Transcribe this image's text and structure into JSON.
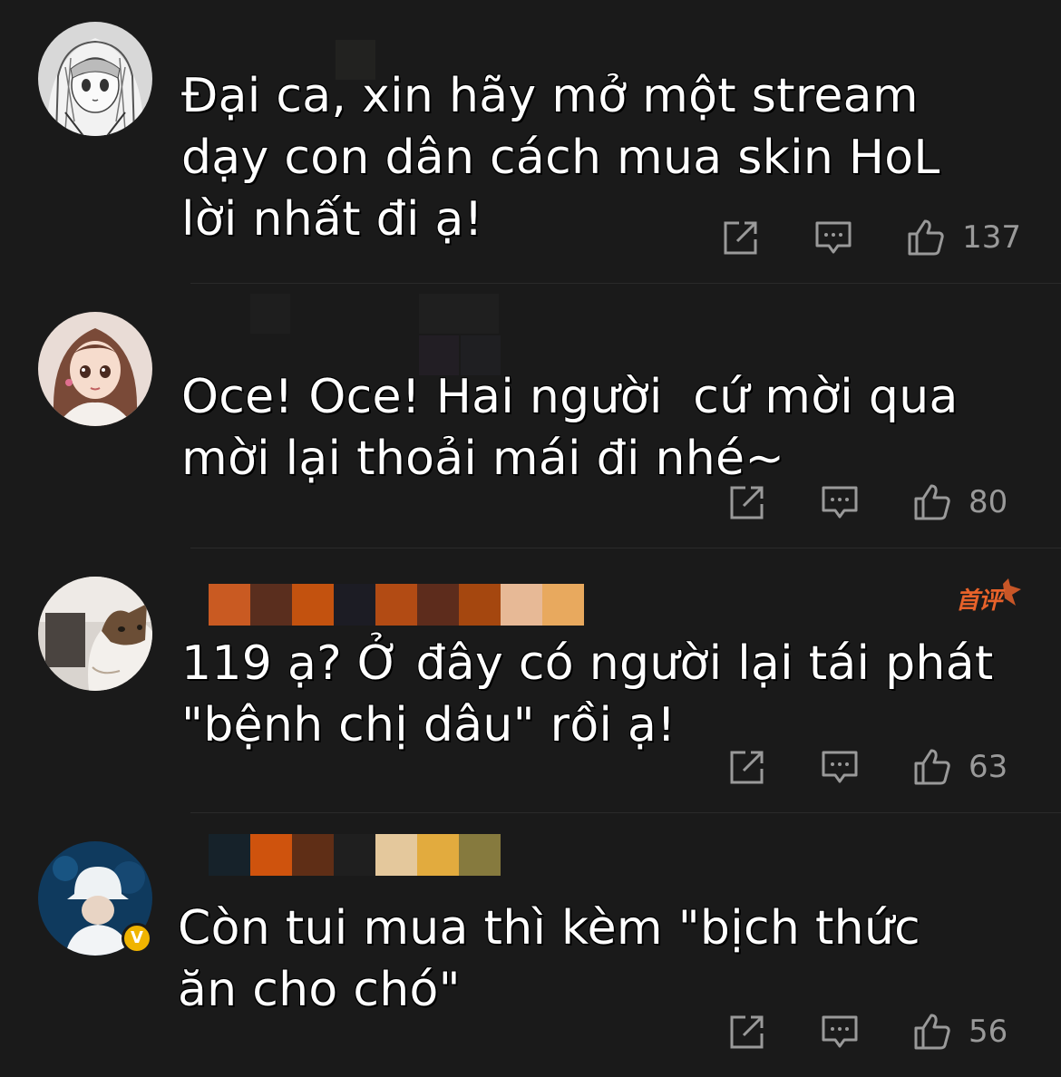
{
  "comments": [
    {
      "avatar": "anime-girl-sketch-avatar",
      "text": "Đại ca, xin hãy mở một stream\ndạy con dân cách mua skin HoL\nlời nhất đi ạ!",
      "likes": "137",
      "username_colors": []
    },
    {
      "avatar": "cartoon-girl-avatar",
      "text": "Oce! Oce! Hai người  cứ mời qua\nmời lại thoải mái đi nhé~",
      "likes": "80",
      "username_colors": []
    },
    {
      "avatar": "cat-photo-avatar",
      "text": "119 ạ? Ở đây có người lại tái phát\n\"bệnh chị dâu\" rồi ạ!",
      "likes": "63",
      "badge": "首评",
      "username_colors": [
        "#c95a22",
        "#5a2e1e",
        "#c3520f",
        "#1c1c24",
        "#b24b14",
        "#5d2c1c",
        "#a5470f",
        "#e7b996",
        "#e8a95e"
      ]
    },
    {
      "avatar": "person-white-hat-avatar",
      "verified": "V",
      "text": "Còn tui mua thì kèm \"bịch thức\năn cho chó\"",
      "likes": "56",
      "username_colors": [
        "#16222a",
        "#cf530d",
        "#5f2e16",
        "#1f1f1f",
        "#e4c89c",
        "#e2ab3e",
        "#867a3e"
      ]
    }
  ],
  "icons": {
    "share": "share-icon",
    "reply": "reply-icon",
    "like": "thumbs-up-icon"
  },
  "colors": {
    "background": "#1a1a1a",
    "icon": "#9a9a9a",
    "badge": "#e8622a",
    "verified": "#f0b400"
  }
}
